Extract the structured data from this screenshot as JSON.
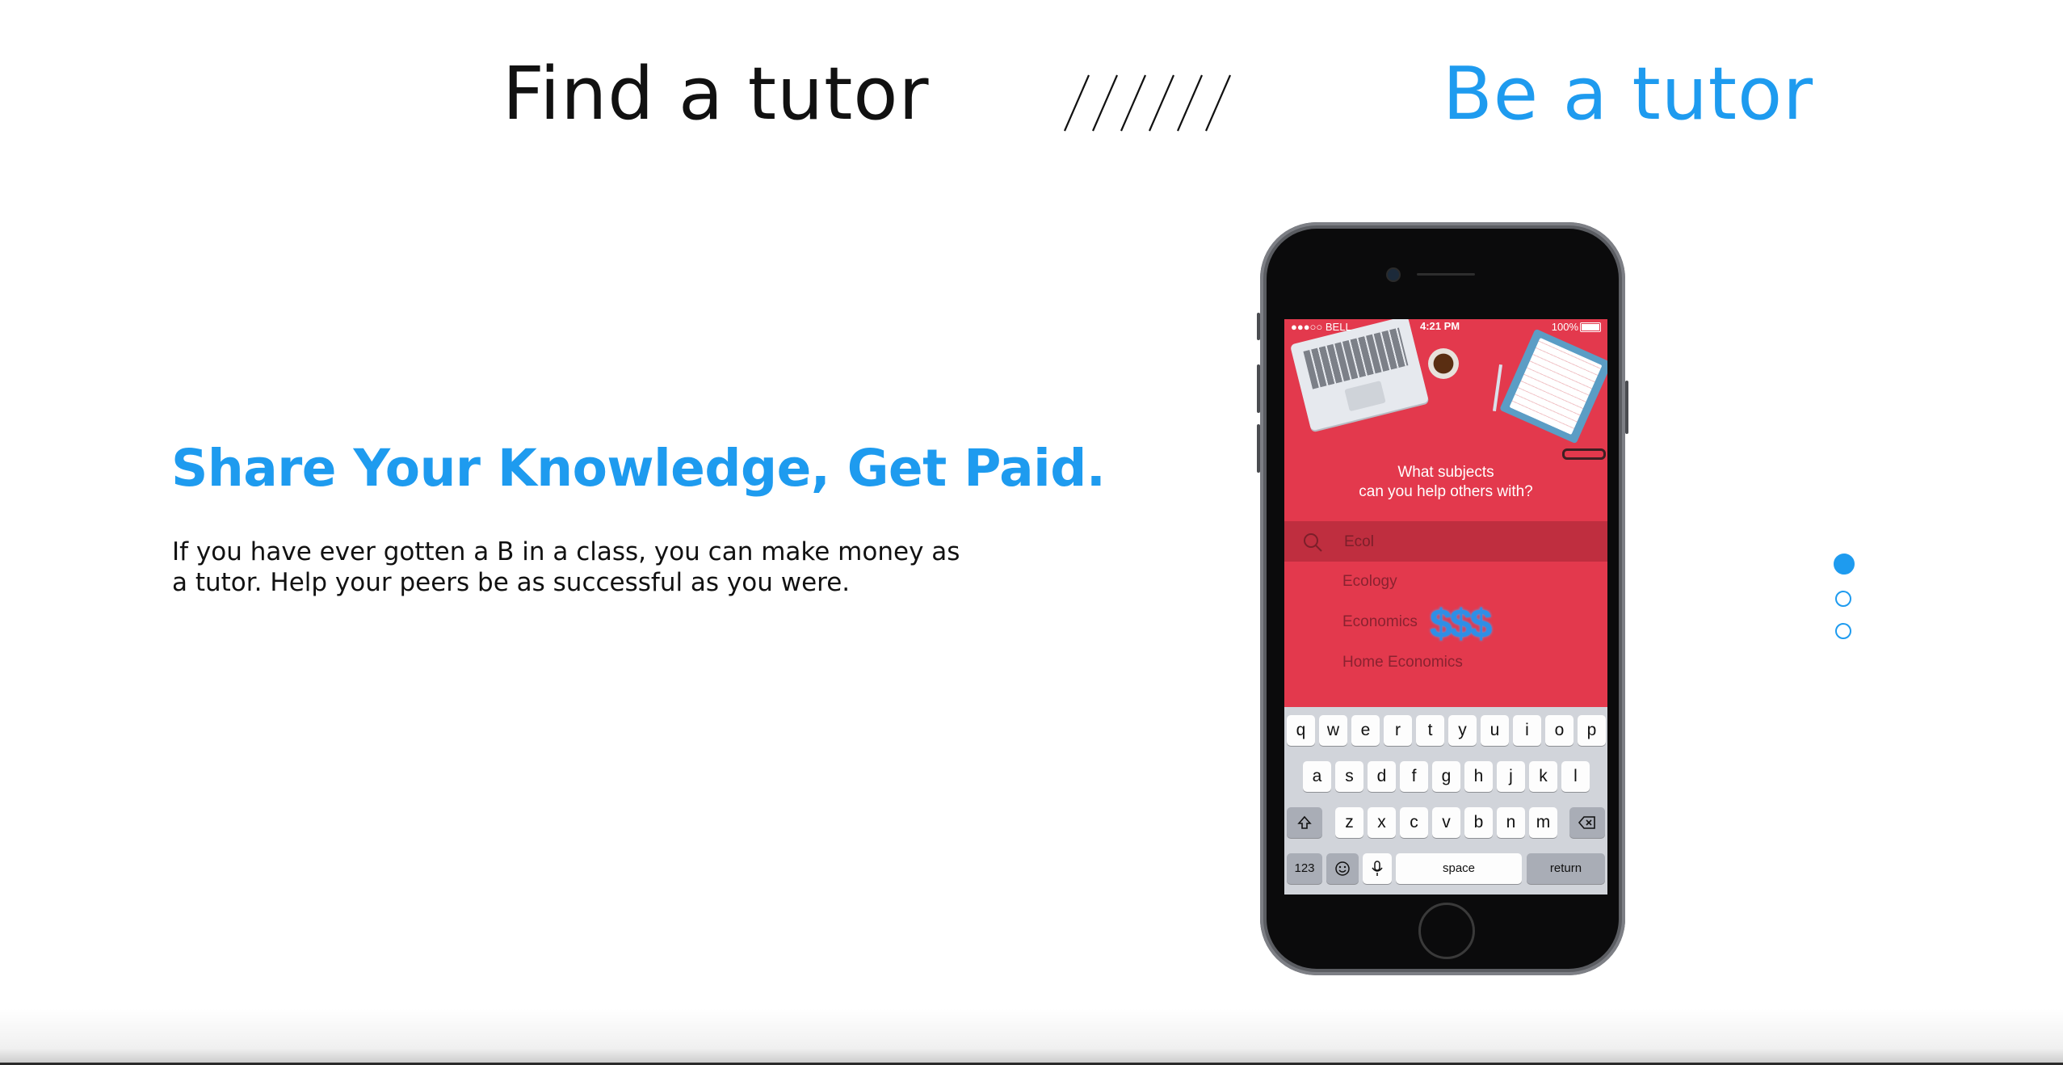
{
  "nav": {
    "find_label": "Find a tutor",
    "separator": "//////",
    "be_label": "Be a tutor",
    "active_color": "#1e9bef"
  },
  "hero": {
    "headline": "Share Your Knowledge, Get Paid.",
    "body": "If you have ever gotten a B in a class, you can make money as a tutor. Help your peers be as successful as you were."
  },
  "pagination": {
    "count": 3,
    "active_index": 0
  },
  "phone": {
    "status": {
      "carrier": "●●●○○ BELL",
      "time": "4:21 PM",
      "battery": "100%"
    },
    "question": "What subjects\ncan you help others with?",
    "search": {
      "value": "Ecol",
      "icon": "search-icon"
    },
    "suggestions": [
      "Ecology",
      "Economics",
      "Home Economics"
    ],
    "money_badge": "$$$",
    "keyboard": {
      "row1": [
        "q",
        "w",
        "e",
        "r",
        "t",
        "y",
        "u",
        "i",
        "o",
        "p"
      ],
      "row2": [
        "a",
        "s",
        "d",
        "f",
        "g",
        "h",
        "j",
        "k",
        "l"
      ],
      "row3": [
        "z",
        "x",
        "c",
        "v",
        "b",
        "n",
        "m"
      ],
      "shift_icon": "shift-icon",
      "delete_icon": "backspace-icon",
      "numbers": "123",
      "emoji_icon": "emoji-icon",
      "mic_icon": "microphone-icon",
      "space": "space",
      "return": "return"
    }
  },
  "colors": {
    "brand_blue": "#1e9bef",
    "screen_red": "#e3394d"
  }
}
